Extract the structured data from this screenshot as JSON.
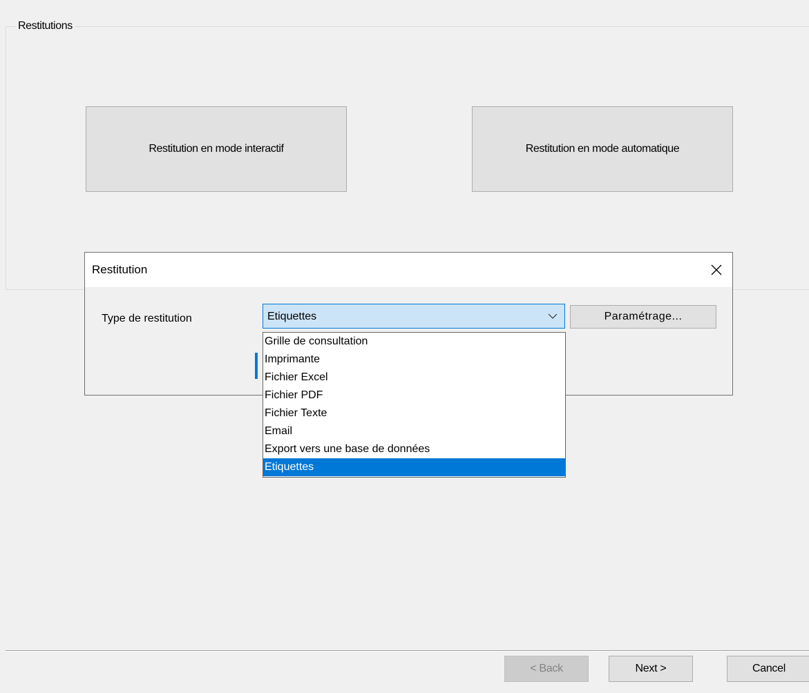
{
  "group": {
    "legend": "Restitutions",
    "interactive_button": "Restitution en mode interactif",
    "automatic_button": "Restitution en mode automatique"
  },
  "dialog": {
    "title": "Restitution",
    "close_icon": "close-icon",
    "type_label": "Type de restitution",
    "combo_value": "Etiquettes",
    "combo_arrow_icon": "chevron-down-icon",
    "param_button": "Paramétrage...",
    "dropdown_items": [
      "Grille de consultation",
      "Imprimante",
      "Fichier Excel",
      "Fichier PDF",
      "Fichier Texte",
      "Email",
      "Export vers une base de données",
      "Etiquettes"
    ],
    "selected_index": 7
  },
  "wizard": {
    "back_label": "< Back",
    "next_label": "Next >",
    "cancel_label": "Cancel",
    "back_disabled": true
  },
  "colors": {
    "accent": "#0078d7",
    "combo_bg": "#cce4f7",
    "window_bg": "#f0f0f0",
    "button_bg": "#e1e1e1"
  }
}
